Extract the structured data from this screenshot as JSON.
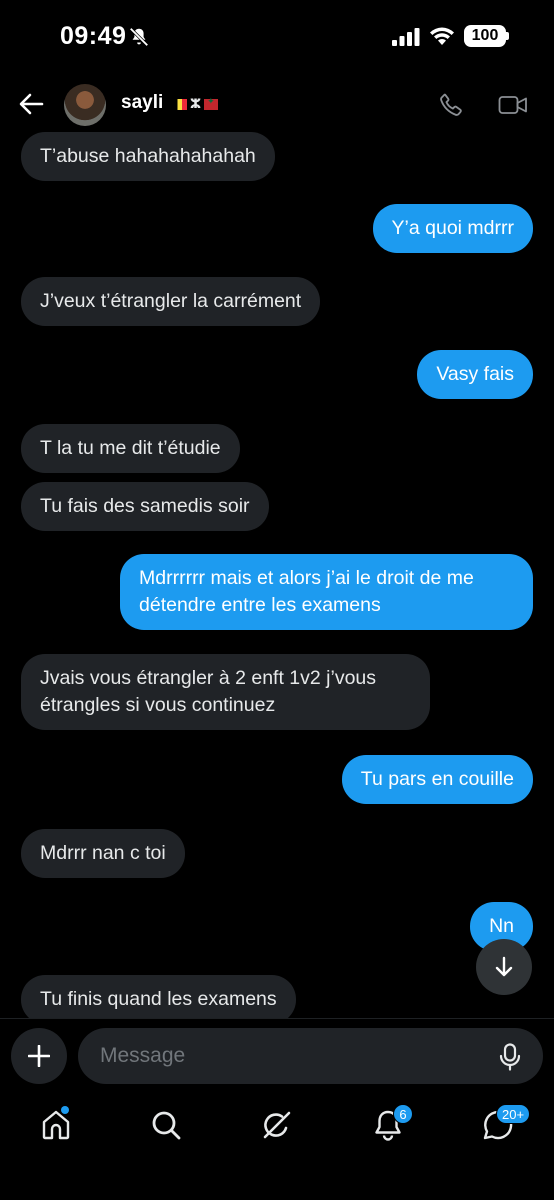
{
  "status_bar": {
    "time": "09:49",
    "battery": "100"
  },
  "header": {
    "contact_name": "sayli",
    "amazigh_symbol": "ⵣ"
  },
  "messages": [
    {
      "side": "in",
      "text": "T’abuse hahahahahahah"
    },
    {
      "side": "out",
      "text": "Y’a quoi mdrrr"
    },
    {
      "side": "in",
      "text": "J’veux t’étrangler la carrément"
    },
    {
      "side": "out",
      "text": "Vasy fais"
    },
    {
      "side": "in",
      "text": "T la tu me dit t’étudie"
    },
    {
      "side": "in",
      "text": "Tu fais des samedis soir"
    },
    {
      "side": "out",
      "text": "Mdrrrrrr mais et alors j’ai le droit de me détendre entre les examens"
    },
    {
      "side": "in",
      "text": "Jvais vous étrangler à 2 enft 1v2 j’vous étrangles si vous continuez"
    },
    {
      "side": "out",
      "text": "Tu pars en couille"
    },
    {
      "side": "in",
      "text": "Mdrrr nan c toi"
    },
    {
      "side": "out",
      "text": "Nn"
    },
    {
      "side": "in",
      "text": "Tu finis quand les examens"
    }
  ],
  "composer": {
    "placeholder": "Message"
  },
  "tabbar": {
    "notifications_badge": "6",
    "messages_badge": "20+"
  },
  "colors": {
    "accent": "#1d9bf0",
    "incoming_bubble": "#202327",
    "background": "#000000"
  }
}
